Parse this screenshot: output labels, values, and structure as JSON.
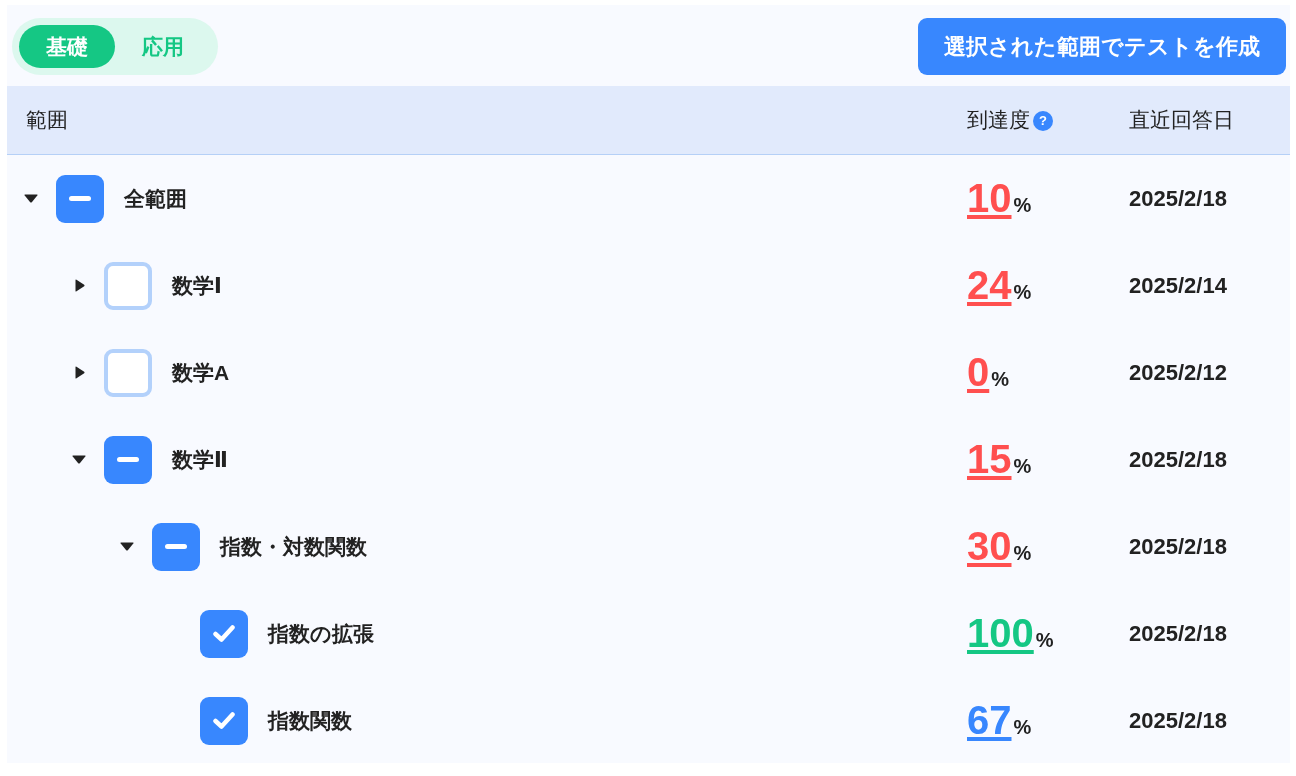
{
  "mode_tabs": [
    {
      "label": "基礎",
      "selected": true
    },
    {
      "label": "応用",
      "selected": false
    }
  ],
  "create_test_button": {
    "label": "選択された範囲でテストを作成"
  },
  "table": {
    "columns": [
      {
        "label": "範囲"
      },
      {
        "label": "到達度",
        "help": "?"
      },
      {
        "label": "直近回答日"
      }
    ],
    "rows": [
      {
        "label": "全範囲",
        "checked": false,
        "partial": true,
        "expanded": true,
        "score": "10",
        "unit": "%",
        "color": "#ff4f4f",
        "date": "2025/2/18",
        "children": [
          {
            "label": "数学Ⅰ",
            "checked": false,
            "partial": false,
            "expanded": false,
            "score": "24",
            "unit": "%",
            "color": "#ff4f4f",
            "date": "2025/2/14"
          },
          {
            "label": "数学A",
            "checked": false,
            "partial": false,
            "expanded": false,
            "score": "0",
            "unit": "%",
            "color": "#ff4f4f",
            "date": "2025/2/12"
          },
          {
            "label": "数学Ⅱ",
            "checked": false,
            "partial": true,
            "expanded": true,
            "score": "15",
            "unit": "%",
            "color": "#ff4f4f",
            "date": "2025/2/18",
            "children": [
              {
                "label": "指数・対数関数",
                "checked": false,
                "partial": true,
                "expanded": true,
                "score": "30",
                "unit": "%",
                "color": "#ff4f4f",
                "date": "2025/2/18",
                "children": [
                  {
                    "label": "指数の拡張",
                    "checked": true,
                    "score": "100",
                    "unit": "%",
                    "color": "#15c784",
                    "date": "2025/2/18"
                  },
                  {
                    "label": "指数関数",
                    "checked": true,
                    "score": "67",
                    "unit": "%",
                    "color": "#3887fe",
                    "date": "2025/2/18"
                  }
                ]
              }
            ]
          }
        ]
      }
    ]
  }
}
